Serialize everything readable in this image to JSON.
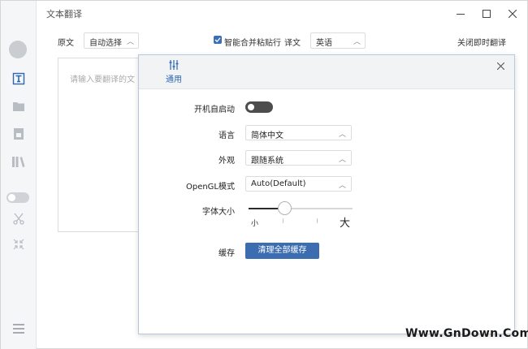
{
  "app": {
    "title": "文本翻译",
    "window_controls": [
      "minimize-icon",
      "maximize-icon",
      "close-icon"
    ]
  },
  "sidebar": {
    "items": [
      {
        "name": "avatar"
      },
      {
        "name": "text-translate-icon",
        "active": true
      },
      {
        "name": "folder-icon"
      },
      {
        "name": "document-icon"
      },
      {
        "name": "library-icon"
      },
      {
        "name": "toggle",
        "state": "off"
      },
      {
        "name": "scissors-icon"
      },
      {
        "name": "collapse-icon"
      },
      {
        "name": "menu-icon"
      }
    ]
  },
  "toolbar": {
    "source_label": "原文",
    "source_lang": "自动选择",
    "merge_paste_label": "智能合并粘贴行",
    "merge_paste_checked": true,
    "target_label": "译文",
    "target_lang": "英语",
    "instant_translate_label": "关闭即时翻译"
  },
  "source_input": {
    "placeholder": "请输入要翻译的文"
  },
  "settings": {
    "tab_label": "通用",
    "tab_icon": "sliders-icon",
    "autostart_label": "开机自启动",
    "autostart_on": false,
    "language_label": "语言",
    "language_value": "简体中文",
    "appearance_label": "外观",
    "appearance_value": "跟随系统",
    "opengl_label": "OpenGL模式",
    "opengl_value": "Auto(Default)",
    "font_size_label": "字体大小",
    "font_size_min_label": "小",
    "font_size_max_label": "大",
    "font_size_level": 0.35,
    "cache_label": "缓存",
    "clear_cache_label": "清理全部缓存"
  },
  "colors": {
    "accent": "#3b6db0",
    "toggle_off": "#4d4d4d"
  },
  "watermark": "Www.GnDown.Com"
}
